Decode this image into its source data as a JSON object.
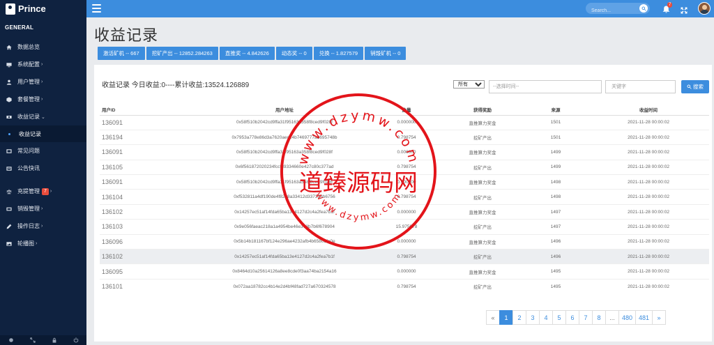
{
  "brand": {
    "name": "Prince"
  },
  "sidebar": {
    "section": "GENERAL",
    "items": [
      {
        "label": "数据总览",
        "icon": "home-icon"
      },
      {
        "label": "系统配置",
        "icon": "monitor-icon",
        "arrow": "›"
      },
      {
        "label": "用户管理",
        "icon": "user-icon",
        "arrow": "›"
      },
      {
        "label": "套餐管理",
        "icon": "box-icon",
        "arrow": "›"
      },
      {
        "label": "收益记录",
        "icon": "money-icon",
        "arrow": "⌄"
      },
      {
        "label": "常见问题",
        "icon": "question-icon"
      },
      {
        "label": "公告快讯",
        "icon": "notice-icon"
      },
      {
        "label": "充提管理",
        "icon": "balance-icon",
        "badge": "7",
        "arrow": "›"
      },
      {
        "label": "销毁管理",
        "icon": "fire-icon",
        "arrow": "›"
      },
      {
        "label": "操作日志",
        "icon": "edit-icon",
        "arrow": "›"
      },
      {
        "label": "轮播图",
        "icon": "image-icon",
        "arrow": "›"
      }
    ],
    "sub_item": "收益记录"
  },
  "topbar": {
    "search_placeholder": "Search...",
    "notification_count": "7"
  },
  "page": {
    "title": "收益记录",
    "stats": [
      "激活矿机 -- 667",
      "挖矿产出 -- 12852.284263",
      "直推奖 -- 4.842626",
      "动态奖 -- 0",
      "兑换 -- 1.827579",
      "销毁矿机 -- 0"
    ],
    "summary": "收益记录 今日收益:0----累计收益:13524.126889",
    "filter": {
      "select_value": "所有",
      "date_placeholder": "--选择时间--",
      "keyword_placeholder": "关键字",
      "search_label": "搜索"
    }
  },
  "table": {
    "headers": [
      "用户ID",
      "用户地址",
      "数量",
      "获得奖励",
      "来源",
      "收益时间"
    ],
    "rows": [
      [
        "136091",
        "0x58f510b2042cd9ffa31f95163a358f8ced9f028f",
        "0.000000",
        "直推算力奖金",
        "1501",
        "2021-11-28 00:00:02"
      ],
      [
        "136194",
        "0x7953a778e86d3a7620aec24b7469777ad695748b",
        "0.798754",
        "挖矿产出",
        "1501",
        "2021-11-28 00:00:02"
      ],
      [
        "136091",
        "0x58f510b2042cd9ffa31f95163a358f8ced9f028f",
        "0.000000",
        "直推算力奖金",
        "1499",
        "2021-11-28 00:00:02"
      ],
      [
        "136105",
        "0x6f561872020234fccfd9334660e427c80c377ad",
        "0.798754",
        "挖矿产出",
        "1499",
        "2021-11-28 00:00:02"
      ],
      [
        "136091",
        "0x58f510b2042cd9ffa31f95163a358f8ced9f028f",
        "0.000000",
        "直推算力奖金",
        "1498",
        "2021-11-28 00:00:02"
      ],
      [
        "136104",
        "0xf532811a4df190de4f8268a33412d337333b6756",
        "0.798754",
        "挖矿产出",
        "1498",
        "2021-11-28 00:00:02"
      ],
      [
        "136102",
        "0x14257ec51af14fda65ba13e4127d2c4a2fea7b1f",
        "0.000000",
        "直推算力奖金",
        "1497",
        "2021-11-28 00:00:02"
      ],
      [
        "136103",
        "0x9e056faeac218a1a4954be46e373b7b6f678904",
        "15.975078",
        "挖矿产出",
        "1497",
        "2021-11-28 00:00:02"
      ],
      [
        "136096",
        "0x5b14b181167bf124e296ae4232afb4b65803fe0e",
        "0.000000",
        "直推算力奖金",
        "1496",
        "2021-11-28 00:00:02"
      ],
      [
        "136102",
        "0x14257ec51af14fda65ba13e4127d2c4a2fea7b1f",
        "0.798754",
        "挖矿产出",
        "1496",
        "2021-11-28 00:00:02"
      ],
      [
        "136095",
        "0x8464d10a25614126a8ee8cde0f3aa74ba2154a16",
        "0.000000",
        "直推算力奖金",
        "1495",
        "2021-11-28 00:00:02"
      ],
      [
        "136101",
        "0x072aa18782cc4b14e2d4bf48fad727a670324578",
        "0.798754",
        "挖矿产出",
        "1495",
        "2021-11-28 00:00:02"
      ]
    ]
  },
  "pagination": {
    "prev": "«",
    "pages": [
      "1",
      "2",
      "3",
      "4",
      "5",
      "6",
      "7",
      "8"
    ],
    "ellipsis": "...",
    "tail": [
      "480",
      "481"
    ],
    "next": "»",
    "active": "1"
  },
  "watermark": {
    "center": "道臻源码网",
    "ring_top": "www.dzymw.com",
    "ring_bottom": "www.dzymw.com",
    "color": "#e3141a"
  }
}
